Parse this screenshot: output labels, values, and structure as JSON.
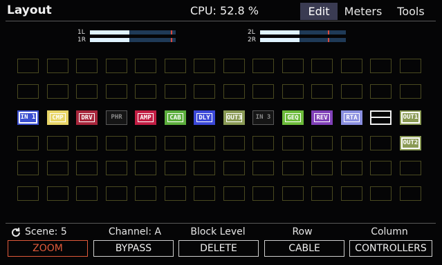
{
  "header": {
    "title": "Layout",
    "cpu": "CPU: 52.8 %",
    "tabs": [
      {
        "label": "Edit",
        "active": true
      },
      {
        "label": "Meters",
        "active": false
      },
      {
        "label": "Tools",
        "active": false
      }
    ]
  },
  "meters": [
    {
      "label": "1L",
      "level": 0.46,
      "peak": 0.95
    },
    {
      "label": "1R",
      "level": 0.46,
      "peak": 0.95
    },
    {
      "label": "2L",
      "level": 0.46,
      "peak": 0.8
    },
    {
      "label": "2R",
      "level": 0.46,
      "peak": 0.8
    }
  ],
  "grid": {
    "columns": 14,
    "rows": 6
  },
  "blocks": [
    {
      "label": "IN 1",
      "row": 2,
      "col": 0,
      "style": "outlined",
      "color": "#3a4fd0",
      "text": "#ffffff"
    },
    {
      "label": "CMP",
      "row": 2,
      "col": 1,
      "style": "filled",
      "color": "#e8d566",
      "text": "#ffffff"
    },
    {
      "label": "DRV",
      "row": 2,
      "col": 2,
      "style": "filled",
      "color": "#a8263c",
      "text": "#ffffff"
    },
    {
      "label": "PHR",
      "row": 2,
      "col": 3,
      "style": "bypassed",
      "color": "#5a5a5a",
      "text": "#8a8a8a"
    },
    {
      "label": "AMP",
      "row": 2,
      "col": 4,
      "style": "filled",
      "color": "#c21e44",
      "text": "#ffffff"
    },
    {
      "label": "CAB",
      "row": 2,
      "col": 5,
      "style": "filled",
      "color": "#5cae3c",
      "text": "#ffffff"
    },
    {
      "label": "DLY",
      "row": 2,
      "col": 6,
      "style": "filled",
      "color": "#3b48d8",
      "text": "#ffffff"
    },
    {
      "label": "OUT3",
      "row": 2,
      "col": 7,
      "style": "filled",
      "color": "#8a9a55",
      "text": "#ffffff"
    },
    {
      "label": "IN 3",
      "row": 2,
      "col": 8,
      "style": "bypassed",
      "color": "#5a5a5a",
      "text": "#8a8a8a"
    },
    {
      "label": "GEQ",
      "row": 2,
      "col": 9,
      "style": "filled",
      "color": "#6cbb3a",
      "text": "#ffffff"
    },
    {
      "label": "REV",
      "row": 2,
      "col": 10,
      "style": "filled",
      "color": "#8040b8",
      "text": "#ffffff"
    },
    {
      "label": "RTA",
      "row": 2,
      "col": 11,
      "style": "filled",
      "color": "#8a8fe0",
      "text": "#ffffff"
    },
    {
      "label": "OUT1",
      "row": 2,
      "col": 13,
      "style": "outlined",
      "color": "#8a9a55",
      "text": "#ffffff"
    },
    {
      "label": "OUT2",
      "row": 3,
      "col": 13,
      "style": "outlined",
      "color": "#8a9a55",
      "text": "#ffffff"
    }
  ],
  "footer": {
    "knobs": {
      "scene": "Scene: 5",
      "channel": "Channel: A",
      "block_level": "Block Level",
      "row": "Row",
      "column": "Column"
    },
    "buttons": {
      "zoom": "ZOOM",
      "bypass": "BYPASS",
      "delete": "DELETE",
      "cable": "CABLE",
      "controllers": "CONTROLLERS"
    }
  },
  "colors": {
    "accent_tab": "#3a3b52",
    "empty_cell": "#4a4a20",
    "zoom_highlight": "#e05a3a",
    "meter_track": "#1f3a57",
    "meter_peak": "#d94a3e"
  }
}
